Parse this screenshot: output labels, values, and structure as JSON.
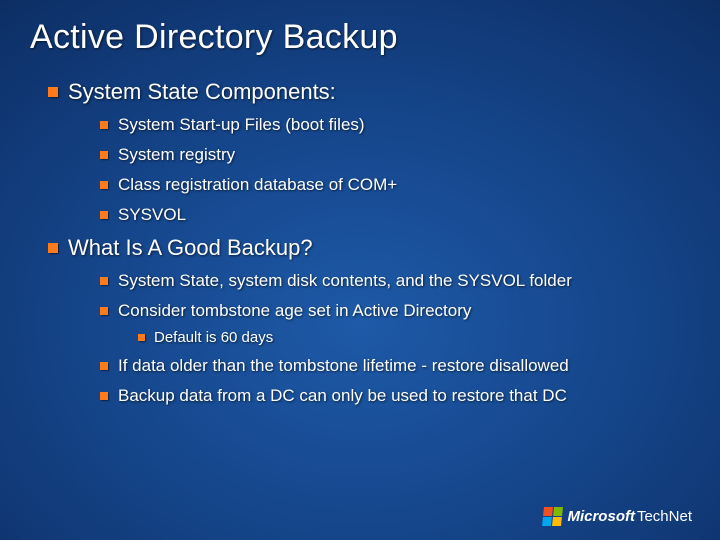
{
  "title": "Active Directory Backup",
  "sections": [
    {
      "heading": "System State Components:",
      "items": [
        {
          "text": "System Start-up Files (boot files)"
        },
        {
          "text": "System registry"
        },
        {
          "text": "Class registration database of COM+"
        },
        {
          "text": "SYSVOL"
        }
      ]
    },
    {
      "heading": "What Is A Good Backup?",
      "items": [
        {
          "text": "System State, system disk contents, and the SYSVOL folder"
        },
        {
          "text": "Consider tombstone age set in Active Directory",
          "sub": [
            {
              "text": "Default is 60 days"
            }
          ]
        },
        {
          "text": "If data older than the tombstone lifetime - restore  disallowed"
        },
        {
          "text": "Backup data from a DC can only be used to restore that DC"
        }
      ]
    }
  ],
  "footer": {
    "brand": "Microsoft",
    "sub": "TechNet"
  }
}
